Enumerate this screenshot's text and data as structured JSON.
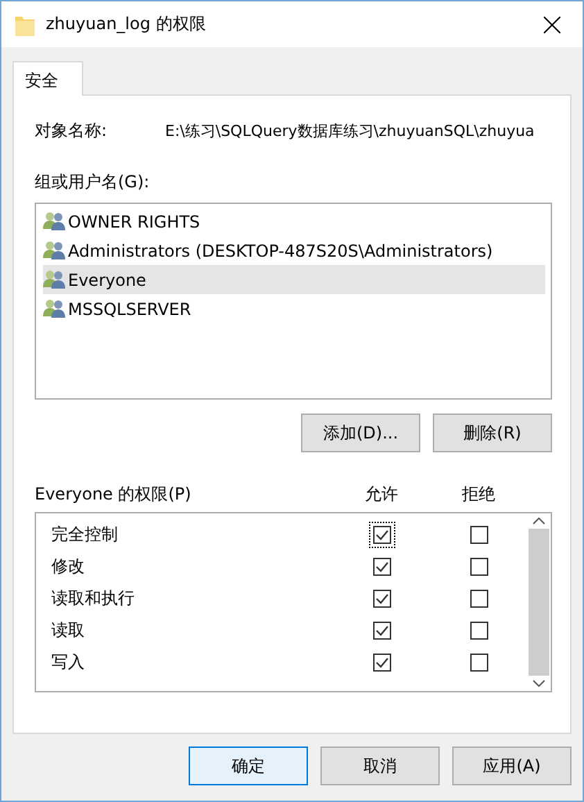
{
  "window": {
    "title": "zhuyuan_log 的权限"
  },
  "tabs": [
    {
      "label": "安全",
      "selected": true
    }
  ],
  "object_name": {
    "label": "对象名称:",
    "value": "E:\\练习\\SQLQuery数据库练习\\zhuyuanSQL\\zhuyua"
  },
  "users": {
    "label": "组或用户名(G):",
    "items": [
      {
        "name": "OWNER RIGHTS",
        "selected": false
      },
      {
        "name": "Administrators (DESKTOP-487S20S\\Administrators)",
        "selected": false
      },
      {
        "name": "Everyone",
        "selected": true
      },
      {
        "name": "MSSQLSERVER",
        "selected": false
      }
    ],
    "buttons": [
      "添加(D)...",
      "删除(R)"
    ]
  },
  "permissions": {
    "label": "Everyone 的权限(P)",
    "allow_header": "允许",
    "deny_header": "拒绝",
    "rows": [
      {
        "name": "完全控制",
        "allow": true,
        "deny": false,
        "focused": true
      },
      {
        "name": "修改",
        "allow": true,
        "deny": false,
        "focused": false
      },
      {
        "name": "读取和执行",
        "allow": true,
        "deny": false,
        "focused": false
      },
      {
        "name": "读取",
        "allow": true,
        "deny": false,
        "focused": false
      },
      {
        "name": "写入",
        "allow": true,
        "deny": false,
        "focused": false
      }
    ]
  },
  "buttons": [
    {
      "label": "确定",
      "default": true
    },
    {
      "label": "取消",
      "default": false
    },
    {
      "label": "应用(A)",
      "default": false
    }
  ]
}
